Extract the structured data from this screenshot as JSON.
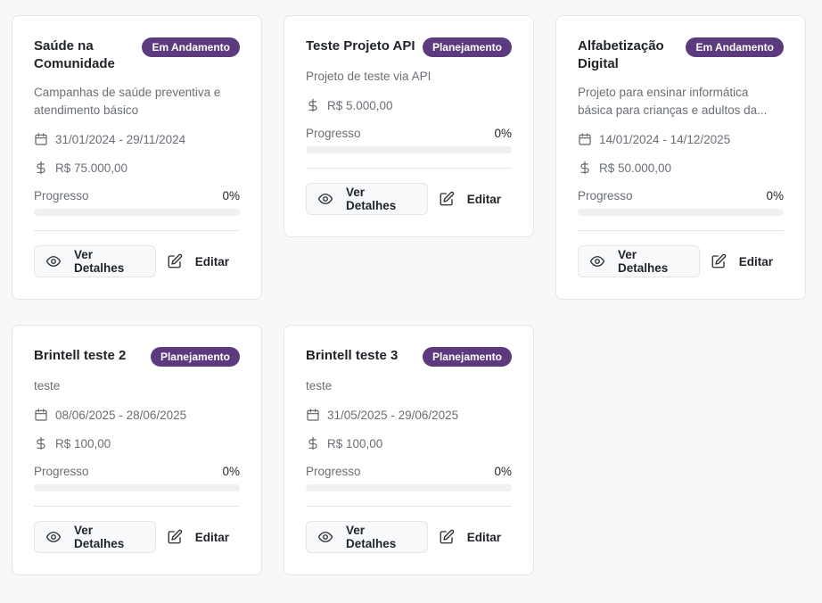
{
  "colors": {
    "badge": "#5b3a7e",
    "page_bg": "#f7f8f8",
    "card_bg": "#ffffff"
  },
  "labels": {
    "progress": "Progresso",
    "details": "Ver Detalhes",
    "edit": "Editar"
  },
  "projects": [
    {
      "title": "Saúde na Comunidade",
      "status": "Em Andamento",
      "description": "Campanhas de saúde preventiva e atendimento básico",
      "dates": "31/01/2024 - 29/11/2024",
      "budget": "R$ 75.000,00",
      "progress_text": "0%",
      "progress": 0
    },
    {
      "title": "Teste Projeto API",
      "status": "Planejamento",
      "description": "Projeto de teste via API",
      "budget": "R$ 5.000,00",
      "progress_text": "0%",
      "progress": 0
    },
    {
      "title": "Alfabetização Digital",
      "status": "Em Andamento",
      "description": "Projeto para ensinar informática básica para crianças e adultos da...",
      "dates": "14/01/2024 - 14/12/2025",
      "budget": "R$ 50.000,00",
      "progress_text": "0%",
      "progress": 0
    },
    {
      "title": "Brintell teste 2",
      "status": "Planejamento",
      "description": "teste",
      "dates": "08/06/2025 - 28/06/2025",
      "budget": "R$ 100,00",
      "progress_text": "0%",
      "progress": 0
    },
    {
      "title": "Brintell teste 3",
      "status": "Planejamento",
      "description": "teste",
      "dates": "31/05/2025 - 29/06/2025",
      "budget": "R$ 100,00",
      "progress_text": "0%",
      "progress": 0
    }
  ]
}
